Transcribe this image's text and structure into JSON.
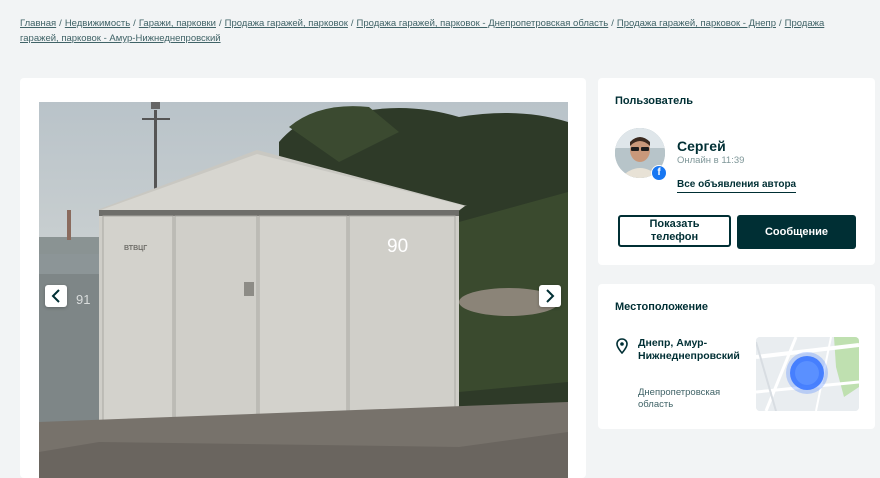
{
  "breadcrumbs": [
    "Главная",
    "Недвижимость",
    "Гаражи, парковки",
    "Продажа гаражей, парковок",
    "Продажа гаражей, парковок - Днепропетровская область",
    "Продажа гаражей, парковок - Днепр",
    "Продажа гаражей, парковок - Амур-Нижнеднепровский"
  ],
  "gallery": {
    "photo_labels": {
      "main_number": "90",
      "side_number": "91",
      "door_brand": "ВТВЦГ"
    },
    "prev_icon": "chevron-left-icon",
    "next_icon": "chevron-right-icon"
  },
  "user": {
    "section_title": "Пользователь",
    "name": "Сергей",
    "status": "Онлайн в 11:39",
    "all_ads_link": "Все объявления автора",
    "show_phone_button": "Показать телефон",
    "message_button": "Сообщение",
    "social_badge": "f",
    "social_badge_color": "#1877f2"
  },
  "location": {
    "section_title": "Местоположение",
    "city": "Днепр, Амур-Нижнеднепровский",
    "region": "Днепропетровская область",
    "pin_icon": "location-pin-icon",
    "map_marker_color": "#3a77ff"
  },
  "colors": {
    "primary": "#002f34",
    "background": "#f2f4f5",
    "muted": "#406367"
  }
}
